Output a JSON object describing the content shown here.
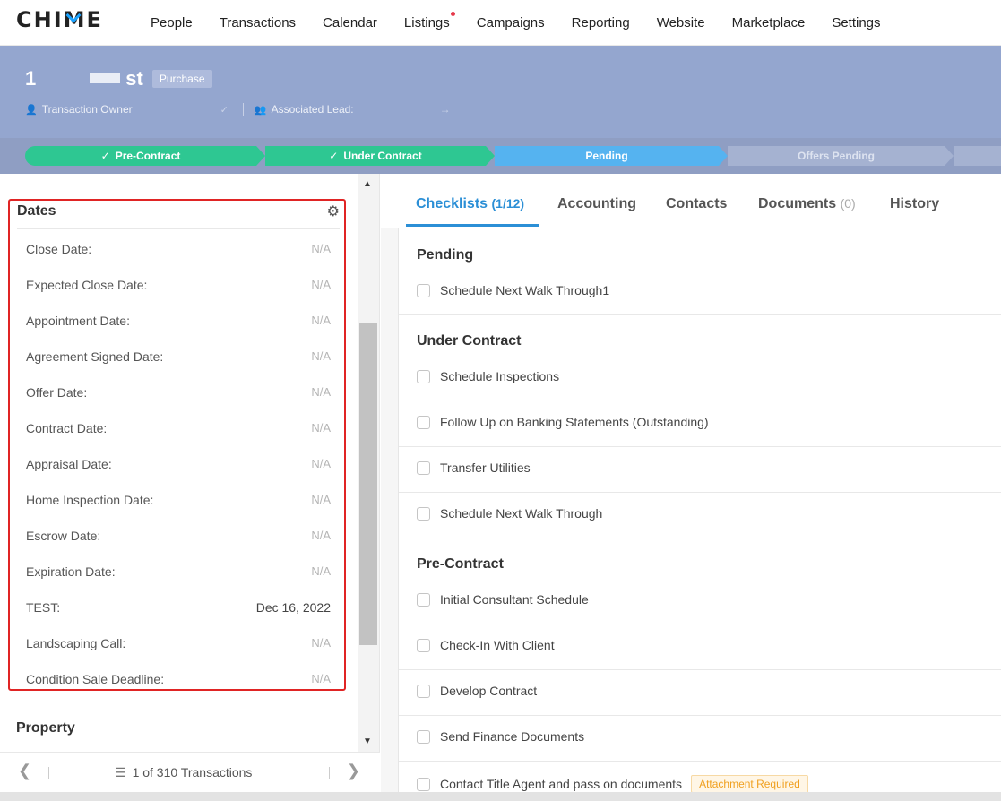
{
  "nav": {
    "logo": "CHIME",
    "items": [
      "People",
      "Transactions",
      "Calendar",
      "Listings",
      "Campaigns",
      "Reporting",
      "Website",
      "Marketplace",
      "Settings"
    ]
  },
  "header": {
    "title_prefix": "1",
    "title_suffix": "st",
    "badge": "Purchase",
    "owner_label": "Transaction Owner",
    "lead_label": "Associated Lead:"
  },
  "stepper": {
    "steps": [
      {
        "label": "Pre-Contract",
        "state": "done"
      },
      {
        "label": "Under Contract",
        "state": "done"
      },
      {
        "label": "Pending",
        "state": "current"
      },
      {
        "label": "Offers Pending",
        "state": "todo"
      }
    ]
  },
  "dates": {
    "title": "Dates",
    "rows": [
      {
        "label": "Close Date:",
        "value": "N/A"
      },
      {
        "label": "Expected Close Date:",
        "value": "N/A"
      },
      {
        "label": "Appointment Date:",
        "value": "N/A"
      },
      {
        "label": "Agreement Signed Date:",
        "value": "N/A"
      },
      {
        "label": "Offer Date:",
        "value": "N/A"
      },
      {
        "label": "Contract Date:",
        "value": "N/A"
      },
      {
        "label": "Appraisal Date:",
        "value": "N/A"
      },
      {
        "label": "Home Inspection Date:",
        "value": "N/A"
      },
      {
        "label": "Escrow Date:",
        "value": "N/A"
      },
      {
        "label": "Expiration Date:",
        "value": "N/A"
      },
      {
        "label": "TEST:",
        "value": "Dec 16, 2022"
      },
      {
        "label": "Landscaping Call:",
        "value": "N/A"
      },
      {
        "label": "Condition Sale Deadline:",
        "value": "N/A"
      }
    ]
  },
  "property": {
    "title": "Property"
  },
  "pager": {
    "text": "1 of 310 Transactions"
  },
  "tabs": [
    {
      "label": "Checklists",
      "count": "(1/12)"
    },
    {
      "label": "Accounting",
      "count": ""
    },
    {
      "label": "Contacts",
      "count": ""
    },
    {
      "label": "Documents",
      "count": "(0)"
    },
    {
      "label": "History",
      "count": ""
    }
  ],
  "checklists": {
    "sections": [
      {
        "title": "Pending",
        "items": [
          "Schedule Next Walk Through1"
        ]
      },
      {
        "title": "Under Contract",
        "items": [
          "Schedule Inspections",
          "Follow Up on Banking Statements (Outstanding)",
          "Transfer Utilities",
          "Schedule Next Walk Through"
        ]
      },
      {
        "title": "Pre-Contract",
        "items": [
          "Initial Consultant Schedule",
          "Check-In With Client",
          "Develop Contract",
          "Send Finance Documents",
          "Contact Title Agent and pass on documents"
        ]
      }
    ],
    "attachment_badge": "Attachment Required"
  },
  "colors": {
    "accent": "#2b8fd6",
    "header_bg": "#94a6cf",
    "step_done": "#2ec792",
    "step_current": "#55b3f0",
    "step_todo": "#a5b2d1",
    "highlight_border": "#e02424"
  }
}
